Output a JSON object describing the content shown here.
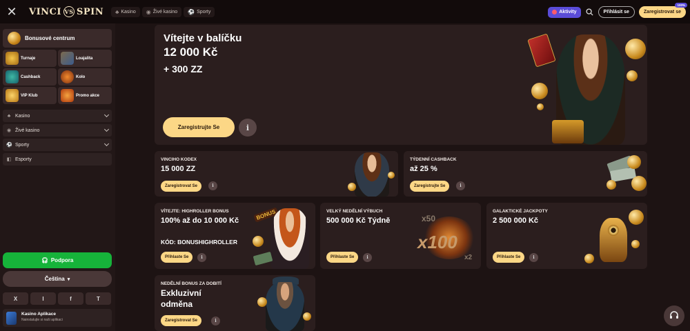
{
  "topbar": {
    "logo_left": "VINCI",
    "logo_mark": "VS",
    "logo_right": "SPIN",
    "nav": [
      {
        "label": "Kasino",
        "icon": "cards-icon"
      },
      {
        "label": "Živé kasino",
        "icon": "live-icon"
      },
      {
        "label": "Sporty",
        "icon": "ball-icon"
      }
    ],
    "activity_label": "Aktivity",
    "login_label": "Přihlásit se",
    "register_label": "Zaregistrovat se",
    "register_badge": "100%"
  },
  "sidebar": {
    "bonus_center": "Bonusové centrum",
    "quick": [
      "Turnaje",
      "Loajalita",
      "Cashback",
      "Kolo",
      "VIP Klub",
      "Promo akce"
    ],
    "menu": [
      {
        "label": "Kasino",
        "icon": "cards-icon",
        "expandable": true
      },
      {
        "label": "Živé kasino",
        "icon": "live-icon",
        "expandable": true
      },
      {
        "label": "Sporty",
        "icon": "ball-icon",
        "expandable": true
      },
      {
        "label": "Esporty",
        "icon": "gamepad-icon",
        "expandable": false
      }
    ],
    "support": "Podpora",
    "language": "Čeština",
    "socials": [
      "X",
      "I",
      "f",
      "T"
    ],
    "app_title": "Kasino Aplikace",
    "app_sub": "Nainstalujte si naši aplikaci"
  },
  "hero": {
    "line1": "Vítejte v balíčku",
    "line2": "12 000 Kč",
    "line3": "+ 300 ZZ",
    "cta": "Zaregistrujte Se",
    "info": "i"
  },
  "cards": [
    {
      "eyebrow": "VINCIHO KODEX",
      "title": "15 000 ZZ",
      "button": "Zaregistrovat Se"
    },
    {
      "eyebrow": "TÝDENNÍ CASHBACK",
      "title": "až 25 %",
      "button": "Zaregistrujte Se"
    },
    {
      "eyebrow": "VÍTEJTE: HIGHROLLER BONUS",
      "title": "100% až do 10 000 Kč",
      "code": "KÓD: BONUSHIGHROLLER",
      "button": "Přihlaste Se"
    },
    {
      "eyebrow": "VELKÝ NEDĚLNÍ VÝBUCH",
      "title": "500 000 Kč Týdně",
      "button": "Přihlaste Se"
    },
    {
      "eyebrow": "GALAKTICKÉ JACKPOTY",
      "title": "2 500 000 Kč",
      "button": "Přihlaste Se"
    },
    {
      "eyebrow": "NEDĚLNÍ BONUS ZA DOBITÍ",
      "title": "Exkluzivní odměna",
      "button": "Zaregistrovat Se"
    }
  ],
  "illustration_text": {
    "x50": "x50",
    "x100": "x100",
    "x2": "x2",
    "bonus": "BONUS"
  },
  "colors": {
    "accent": "#fcd786",
    "support": "#16b33a",
    "activity": "#5a4cd8",
    "card_bg": "#2b1e1e"
  }
}
